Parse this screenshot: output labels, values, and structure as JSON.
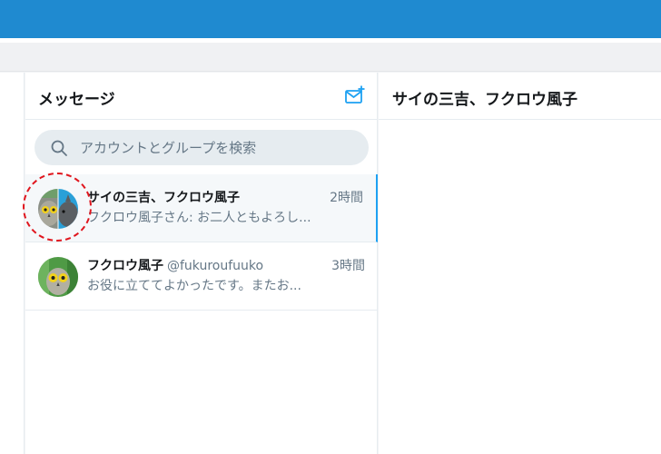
{
  "panel": {
    "title": "メッセージ",
    "compose_icon": "new-message-icon"
  },
  "search": {
    "placeholder": "アカウントとグループを検索",
    "icon": "search-icon"
  },
  "conversations": [
    {
      "name": "サイの三吉、フクロウ風子",
      "handle": "",
      "time": "2時間",
      "snippet": "フクロウ風子さん: お二人ともよろし...",
      "selected": true,
      "avatar": "group-avatar"
    },
    {
      "name": "フクロウ風子",
      "handle": "@fukuroufuuko",
      "time": "3時間",
      "snippet": "お役に立ててよかったです。またお...",
      "selected": false,
      "avatar": "owl-avatar"
    }
  ],
  "conversation_view": {
    "title": "サイの三吉、フクロウ風子"
  },
  "colors": {
    "topbar": "#1f8ad0",
    "accent": "#1da1f2",
    "highlight": "#e0161e"
  }
}
